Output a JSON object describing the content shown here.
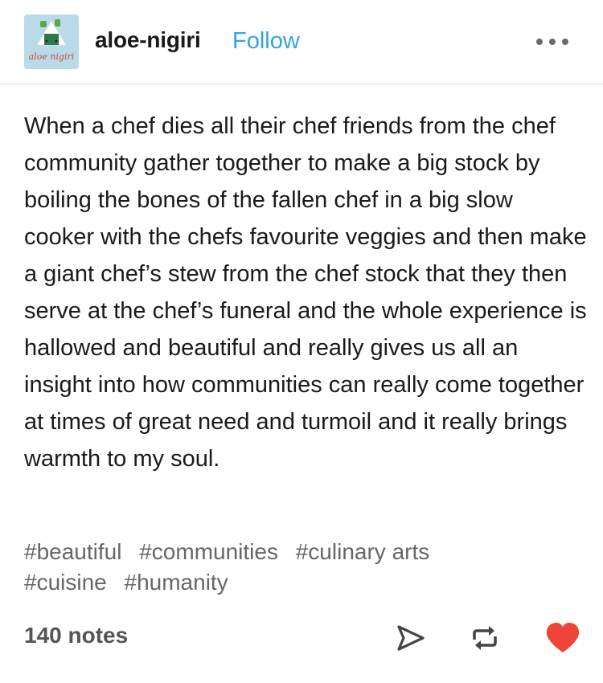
{
  "post": {
    "avatar": {
      "icon": "onigiri-avatar",
      "caption": "aloe nigiri",
      "background": "#b9dbe9"
    },
    "blog_name": "aloe-nigiri",
    "follow_label": "Follow",
    "more_icon": "ellipsis-icon",
    "body": "When a chef dies all their chef friends from the chef community gather together to make a big stock by boiling the bones of the fallen chef in a big slow cooker with the chefs favourite veggies and then make a giant chef’s stew from the chef stock that they then serve at the chef’s funeral and the whole experience is hallowed and beautiful and really gives us all an insight into how communities can really come together at times of great need and turmoil and it really brings warmth to my soul.",
    "tags": [
      "#beautiful",
      "#communities",
      "#culinary arts",
      "#cuisine",
      "#humanity"
    ],
    "notes": "140 notes",
    "actions": {
      "share_icon": "send-icon",
      "reblog_icon": "reblog-icon",
      "like_icon": "heart-icon",
      "liked": true,
      "like_color": "#f0443a"
    },
    "accent_color": "#33a4e0"
  }
}
